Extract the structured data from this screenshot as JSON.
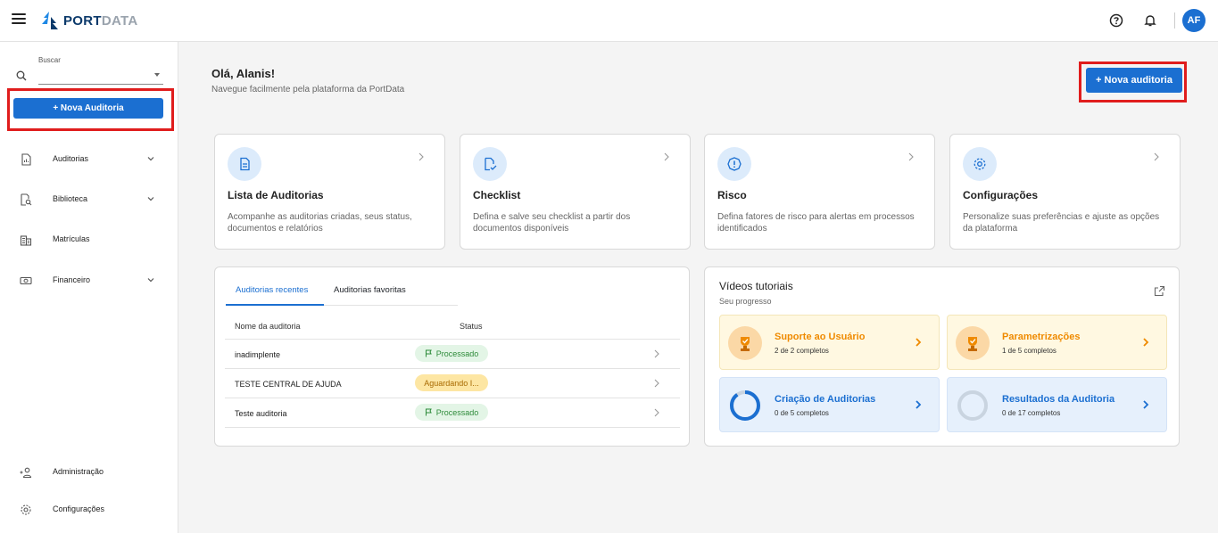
{
  "app": {
    "logo_part1": "PORT",
    "logo_part2": "DATA",
    "user_initials": "AF"
  },
  "colors": {
    "accent": "#1b6fd1",
    "highlight_frame": "#e01d1d",
    "processed": "#2e8b3a",
    "waiting": "#fde6a3",
    "video_orange": "#ef8a00"
  },
  "sidebar": {
    "search_label": "Buscar",
    "new_audit_label": "+ Nova Auditoria",
    "items": [
      {
        "label": "Auditorias",
        "icon": "audit-doc-icon",
        "expandable": true
      },
      {
        "label": "Biblioteca",
        "icon": "library-search-icon",
        "expandable": true
      },
      {
        "label": "Matrículas",
        "icon": "building-icon",
        "expandable": false
      },
      {
        "label": "Financeiro",
        "icon": "money-icon",
        "expandable": true
      }
    ],
    "bottom_items": [
      {
        "label": "Administração",
        "icon": "add-user-icon"
      },
      {
        "label": "Configurações",
        "icon": "gear-icon"
      }
    ]
  },
  "main": {
    "greeting": "Olá, Alanis!",
    "subtitle": "Navegue facilmente pela plataforma da PortData",
    "new_audit_button": "+ Nova auditoria",
    "feature_cards": [
      {
        "title": "Lista de Auditorias",
        "description": "Acompanhe as auditorias criadas, seus status, documentos e relatórios",
        "icon": "document-icon"
      },
      {
        "title": "Checklist",
        "description": "Defina e salve seu checklist a partir dos documentos disponíveis",
        "icon": "checklist-icon"
      },
      {
        "title": "Risco",
        "description": "Defina fatores de risco para alertas em processos identificados",
        "icon": "risk-alert-icon"
      },
      {
        "title": "Configurações",
        "description": "Personalize suas preferências e ajuste as opções da plataforma",
        "icon": "settings-gear-icon"
      }
    ],
    "audits": {
      "tabs": [
        "Auditorias recentes",
        "Auditorias favoritas"
      ],
      "active_tab": "Auditorias recentes",
      "columns": [
        "Nome da auditoria",
        "Status"
      ],
      "rows": [
        {
          "name": "inadimplente",
          "status": "Processado",
          "status_type": "ok"
        },
        {
          "name": "TESTE CENTRAL DE AJUDA",
          "status": "Aguardando I...",
          "status_type": "wait"
        },
        {
          "name": "Teste auditoria",
          "status": "Processado",
          "status_type": "ok"
        }
      ]
    },
    "videos": {
      "title": "Vídeos tutoriais",
      "subtitle": "Seu progresso",
      "items": [
        {
          "title": "Suporte ao Usuário",
          "count": "2 de 2 completos",
          "progress": 1.0,
          "style": "yellow"
        },
        {
          "title": "Parametrizações",
          "count": "1 de 5 completos",
          "progress": 0.2,
          "style": "yellow"
        },
        {
          "title": "Criação de Auditorias",
          "count": "0 de 5 completos",
          "progress": 0.9,
          "style": "blue"
        },
        {
          "title": "Resultados da Auditoria",
          "count": "0 de 17 completos",
          "progress": 0.0,
          "style": "blue"
        }
      ]
    }
  }
}
